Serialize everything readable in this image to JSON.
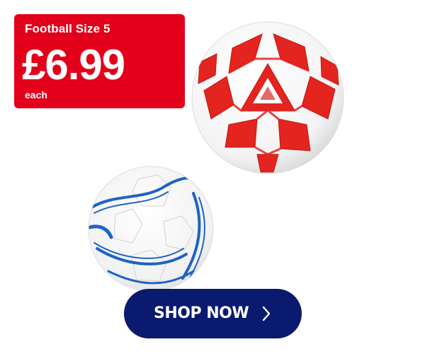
{
  "offer": {
    "product_name": "Football Size 5",
    "price": "£6.99",
    "unit": "each"
  },
  "cta": {
    "label": "SHOP NOW",
    "icon": "chevron-right-icon"
  },
  "products": [
    {
      "name": "red-white-football",
      "color": "#e3241f"
    },
    {
      "name": "blue-white-football",
      "color": "#1f63c3"
    }
  ],
  "colors": {
    "badge": "#e2001a",
    "button": "#0a1a6e",
    "text_on_badge": "#ffffff"
  }
}
